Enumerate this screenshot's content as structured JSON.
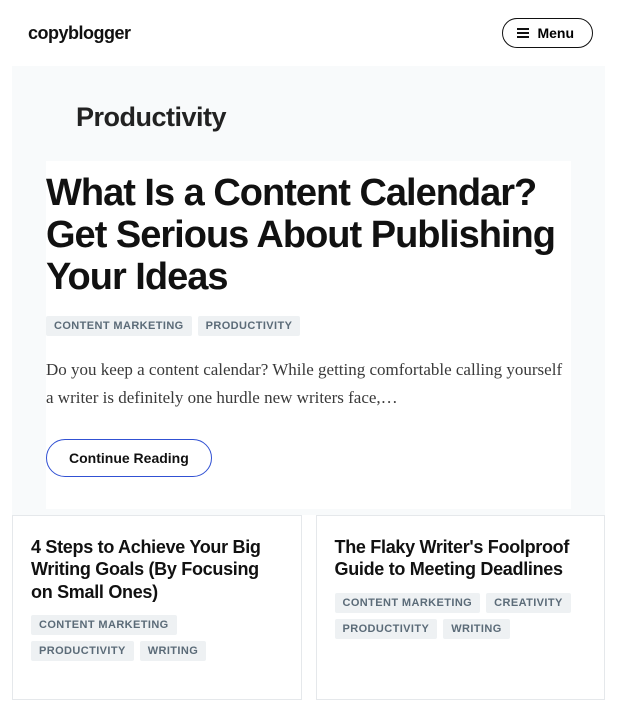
{
  "header": {
    "logo": "copyblogger",
    "menu_label": "Menu"
  },
  "category": {
    "title": "Productivity"
  },
  "feature": {
    "title": "What Is a Content Calendar? Get Serious About Publishing Your Ideas",
    "tags": [
      "CONTENT MARKETING",
      "PRODUCTIVITY"
    ],
    "excerpt": "Do you keep a content calendar? While getting comfortable calling yourself a writer is definitely one hurdle new writers face,…",
    "continue_label": "Continue Reading"
  },
  "cards": [
    {
      "title": "4 Steps to Achieve Your Big Writing Goals (By Focusing on Small Ones)",
      "tags": [
        "CONTENT MARKETING",
        "PRODUCTIVITY",
        "WRITING"
      ]
    },
    {
      "title": "The Flaky Writer's Foolproof Guide to Meeting Deadlines",
      "tags": [
        "CONTENT MARKETING",
        "CREATIVITY",
        "PRODUCTIVITY",
        "WRITING"
      ]
    }
  ]
}
